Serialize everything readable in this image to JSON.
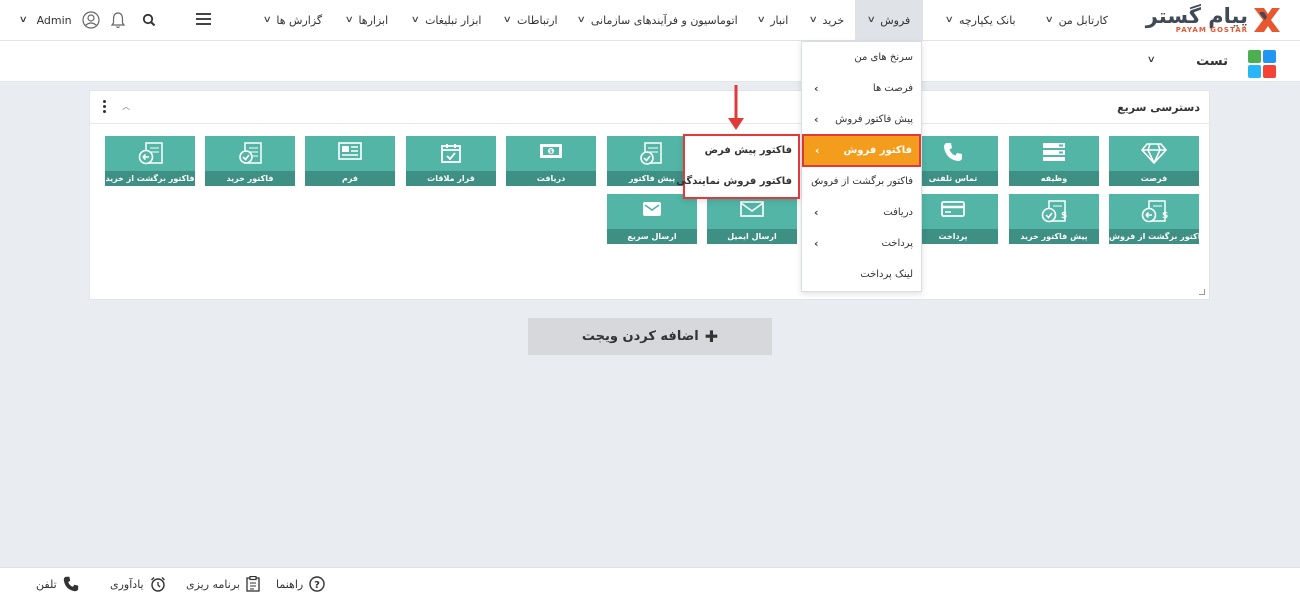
{
  "brand": {
    "name_fa": "پیام گستر",
    "name_en": "PAYAM GOSTAR",
    "mark_color": "#e8572f"
  },
  "nav": {
    "items": [
      {
        "label": "کارتابل من"
      },
      {
        "label": "بانک یکپارچه"
      },
      {
        "label": "فروش"
      },
      {
        "label": "خرید"
      },
      {
        "label": "انبار"
      },
      {
        "label": "اتوماسیون و فرآیندهای سازمانی"
      },
      {
        "label": "ارتباطات"
      },
      {
        "label": "ابزار تبلیغات"
      },
      {
        "label": "ابزارها"
      },
      {
        "label": "گزارش ها"
      }
    ],
    "active_item": "فروش",
    "user": "Admin"
  },
  "subbar": {
    "title": "تست"
  },
  "quick_access": {
    "title": "دسترسی سریع",
    "tiles": [
      {
        "label": "فرصت",
        "icon": "diamond-icon"
      },
      {
        "label": "وظیفه",
        "icon": "task-list-icon"
      },
      {
        "label": "تماس تلفنی",
        "icon": "phone-icon"
      },
      {
        "label": "پیش فاکتور",
        "icon": "proforma-icon"
      },
      {
        "label": "دریافت",
        "icon": "cash-icon"
      },
      {
        "label": "قرار ملاقات",
        "icon": "calendar-icon"
      },
      {
        "label": "فرم",
        "icon": "form-icon"
      },
      {
        "label": "فاکتور خرید",
        "icon": "purchase-invoice-icon"
      },
      {
        "label": "فاکتور برگشت از خرید",
        "icon": "purchase-return-icon"
      },
      {
        "label": "فاکتور برگشت از فروش",
        "icon": "sales-return-icon"
      },
      {
        "label": "پیش فاکتور خرید",
        "icon": "purchase-proforma-icon"
      },
      {
        "label": "پرداخت",
        "icon": "card-icon"
      },
      {
        "label": "ارسال ایمیل",
        "icon": "email-icon"
      },
      {
        "label": "ارسال سریع",
        "icon": "quick-send-icon"
      }
    ]
  },
  "add_widget_label": "اضافه کردن ویجت",
  "sales_menu": {
    "items": [
      {
        "label": "سرنخ های من",
        "has_sub": false
      },
      {
        "label": "فرصت ها",
        "has_sub": true
      },
      {
        "label": "پیش فاکتور فروش",
        "has_sub": true
      },
      {
        "label": "فاکتور فروش",
        "has_sub": true,
        "highlighted": true
      },
      {
        "label": "فاکتور برگشت از فروش",
        "has_sub": true
      },
      {
        "label": "دریافت",
        "has_sub": true
      },
      {
        "label": "پرداخت",
        "has_sub": true
      },
      {
        "label": "لینک پرداخت",
        "has_sub": false
      }
    ],
    "submenu": [
      {
        "label": "فاکتور پیش فرض"
      },
      {
        "label": "فاکتور فروش نمایندگی"
      }
    ]
  },
  "footer": {
    "items": [
      {
        "label": "راهنما",
        "icon": "help-icon"
      },
      {
        "label": "برنامه ریزی",
        "icon": "clipboard-icon"
      },
      {
        "label": "یادآوری",
        "icon": "alarm-icon"
      },
      {
        "label": "تلفن",
        "icon": "phone-icon"
      }
    ]
  },
  "colors": {
    "tile": "#52b5a6",
    "tile_label": "#3e8f84",
    "highlight": "#f49d1d",
    "annotation": "#e03a3a"
  }
}
